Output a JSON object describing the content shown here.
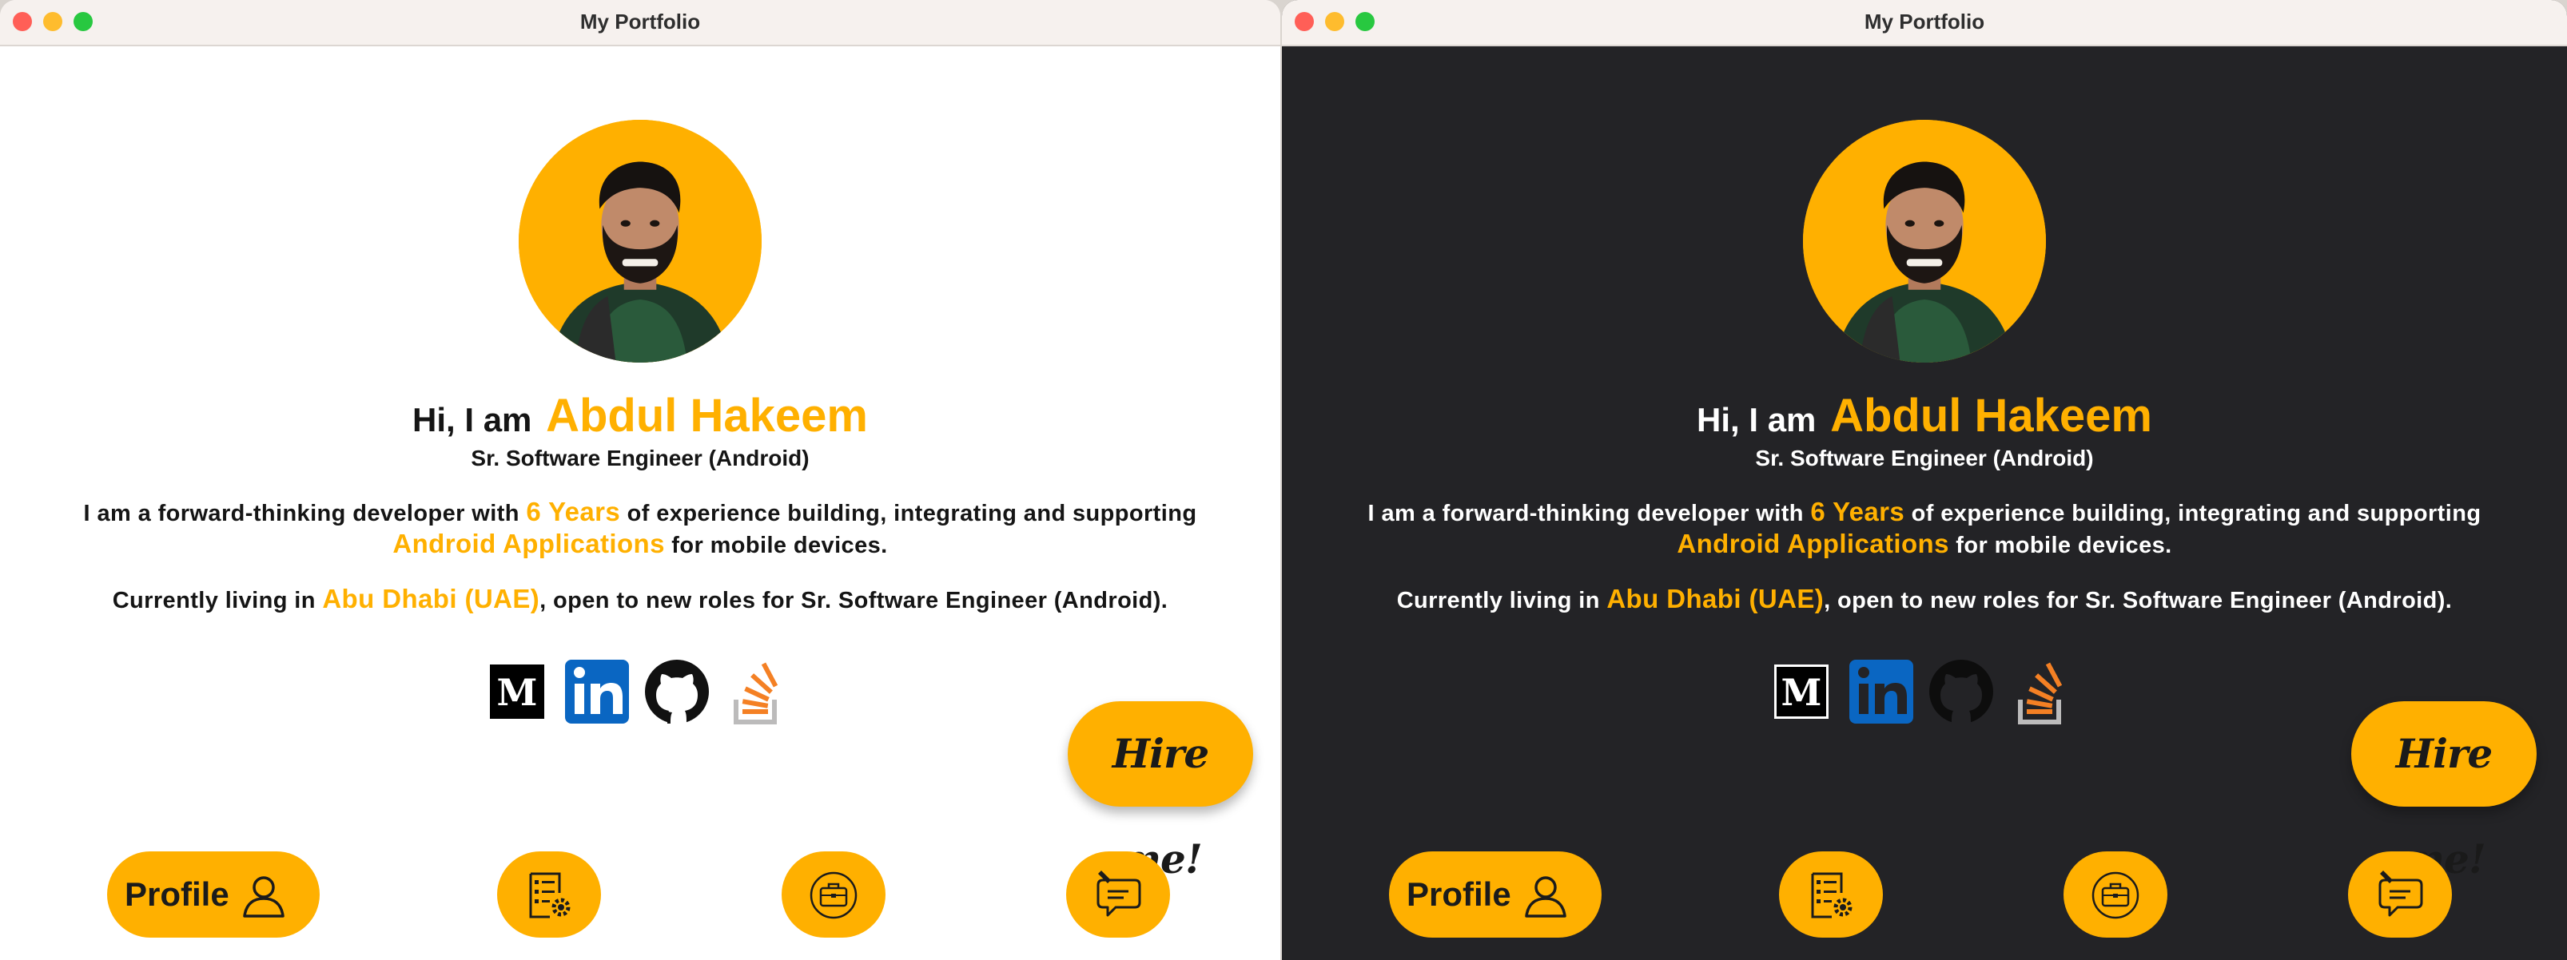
{
  "windows": [
    {
      "theme": "light",
      "title": "My Portfolio",
      "greeting": "Hi, I am",
      "name": "Abdul Hakeem",
      "role": "Sr. Software Engineer (Android)",
      "about": {
        "line1_before": "I am a forward-thinking developer with ",
        "years": "6 Years",
        "line1_after": " of experience building, integrating and supporting",
        "apps": "Android Applications",
        "line2_after": " for mobile devices."
      },
      "location": {
        "before": "Currently living in ",
        "city": "Abu Dhabi (UAE)",
        "after": ", open to new roles for Sr. Software Engineer (Android)."
      },
      "socials": [
        "medium-icon",
        "linkedin-icon",
        "github-icon",
        "stackoverflow-icon"
      ],
      "hire_label": "Hire me!",
      "nav": {
        "profile_label": "Profile",
        "items": [
          "profile-icon",
          "resume-icon",
          "portfolio-briefcase-icon",
          "contact-chat-icon"
        ]
      }
    },
    {
      "theme": "dark",
      "title": "My Portfolio",
      "greeting": "Hi, I am",
      "name": "Abdul Hakeem",
      "role": "Sr. Software Engineer (Android)",
      "about": {
        "line1_before": "I am a forward-thinking developer with ",
        "years": "6 Years",
        "line1_after": " of experience building, integrating and supporting",
        "apps": "Android Applications",
        "line2_after": " for mobile devices."
      },
      "location": {
        "before": "Currently living in ",
        "city": "Abu Dhabi (UAE)",
        "after": ", open to new roles for Sr. Software Engineer (Android)."
      },
      "socials": [
        "medium-icon",
        "linkedin-icon",
        "github-icon",
        "stackoverflow-icon"
      ],
      "hire_label": "Hire me!",
      "nav": {
        "profile_label": "Profile",
        "items": [
          "profile-icon",
          "resume-icon",
          "portfolio-briefcase-icon",
          "contact-chat-icon"
        ]
      }
    }
  ],
  "colors": {
    "accent": "#ffb000",
    "light_bg": "#ffffff",
    "dark_bg": "#232326",
    "linkedin": "#0a66c2",
    "stackoverflow_orange": "#f48024"
  }
}
